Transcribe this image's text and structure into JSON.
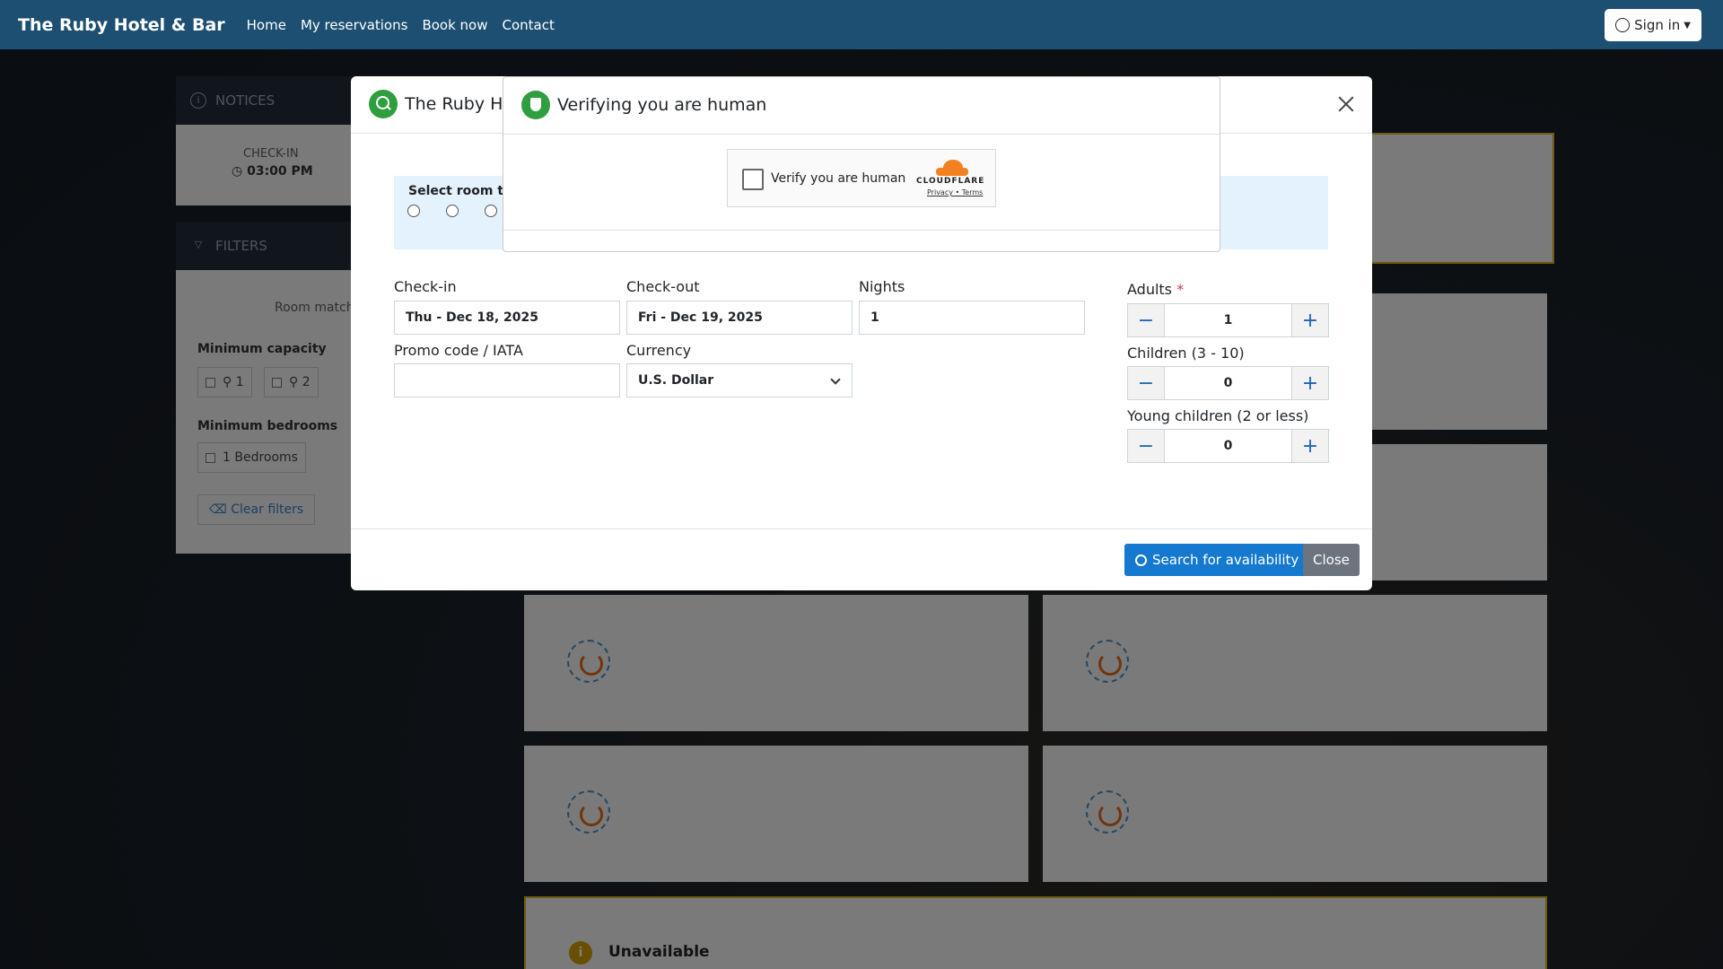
{
  "navbar": {
    "brand": "The Ruby Hotel & Bar",
    "links": [
      "Home",
      "My reservations",
      "Book now",
      "Contact"
    ],
    "signin": "Sign in"
  },
  "background": {
    "notices_header": "NOTICES",
    "checkin_label": "CHECK-IN",
    "checkin_time": "03:00 PM",
    "filters_header": "FILTERS",
    "room_match": "Room match",
    "min_capacity_label": "Minimum capacity",
    "capacity_chips": [
      "1",
      "2"
    ],
    "min_bedrooms_label": "Minimum bedrooms",
    "bedroom_chip": "1 Bedrooms",
    "clear_filters": "Clear filters",
    "unavailable": "Unavailable"
  },
  "modal": {
    "title": "The Ruby Hot",
    "room_type_label": "Select room typ",
    "checkin_label": "Check-in",
    "checkin_value": "Thu - Dec 18, 2025",
    "checkout_label": "Check-out",
    "checkout_value": "Fri - Dec 19, 2025",
    "nights_label": "Nights",
    "nights_value": "1",
    "promo_label": "Promo code / IATA",
    "promo_value": "",
    "currency_label": "Currency",
    "currency_value": "U.S. Dollar",
    "adults_label": "Adults",
    "adults_required": "*",
    "adults_value": "1",
    "children_label": "Children (3 - 10)",
    "children_value": "0",
    "young_label": "Young children (2 or less)",
    "young_value": "0",
    "search_button": "Search for availability",
    "close_button": "Close"
  },
  "verify": {
    "title": "Verifying you are human",
    "checkbox_label": "Verify you are human",
    "brand": "CLOUDFLARE",
    "links": "Privacy • Terms"
  },
  "colors": {
    "navbar": "#1d4f72",
    "primary": "#1479cf",
    "secondary": "#6c757d",
    "accent_green": "#2e9e3f",
    "warning_border": "#e0b220"
  }
}
